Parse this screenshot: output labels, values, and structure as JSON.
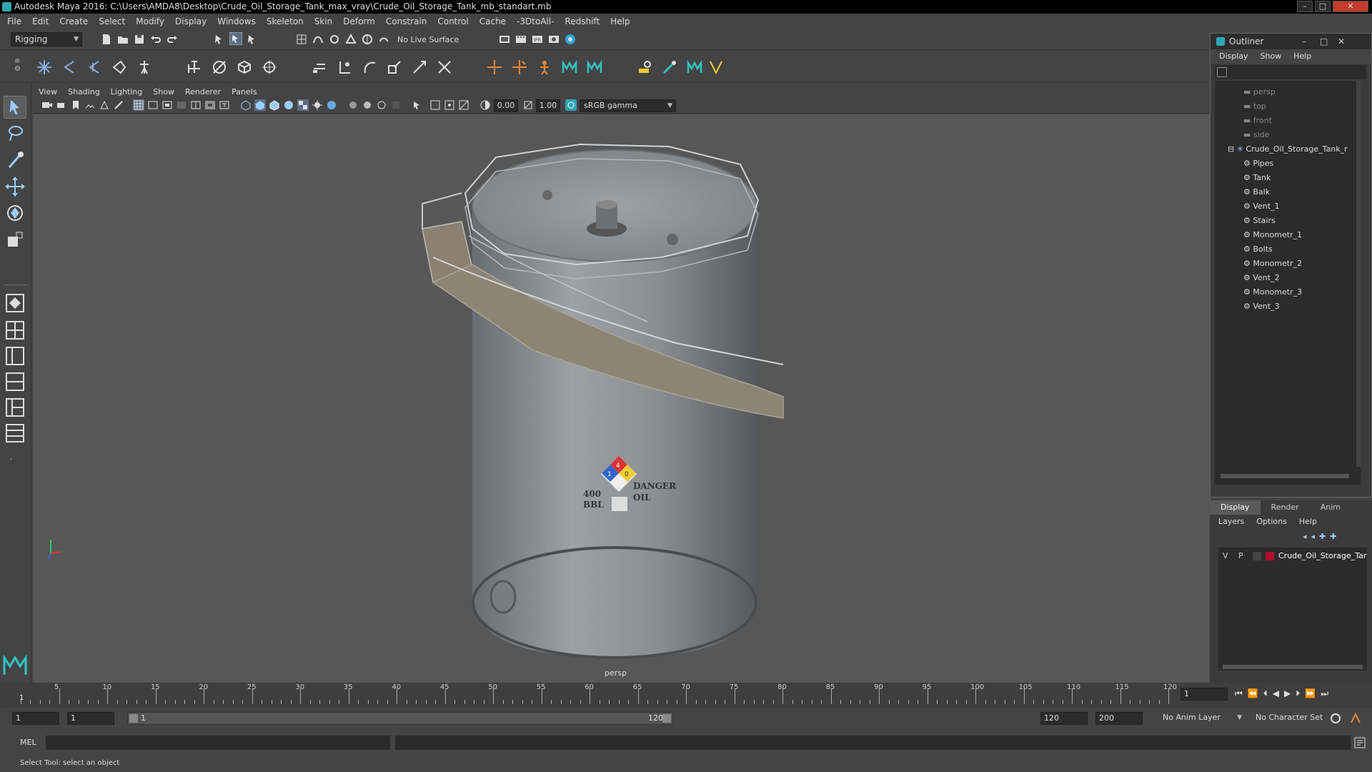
{
  "window": {
    "title": "Autodesk Maya 2016: C:\\Users\\AMDA8\\Desktop\\Crude_Oil_Storage_Tank_max_vray\\Crude_Oil_Storage_Tank_mb_standart.mb"
  },
  "menubar": [
    "File",
    "Edit",
    "Create",
    "Select",
    "Modify",
    "Display",
    "Windows",
    "Skeleton",
    "Skin",
    "Deform",
    "Constrain",
    "Control",
    "Cache",
    "-3DtoAll-",
    "Redshift",
    "Help"
  ],
  "statusline": {
    "mode": "Rigging",
    "live_surface": "No Live Surface"
  },
  "panel_menu": [
    "View",
    "Shading",
    "Lighting",
    "Show",
    "Renderer",
    "Panels"
  ],
  "panel_toolbar": {
    "exposure": "0.00",
    "gamma": "1.00",
    "colorspace": "sRGB gamma"
  },
  "viewport": {
    "camera_label": "persp",
    "decal": {
      "left_line1": "400",
      "left_line2": "BBL",
      "right_line1": "DANGER",
      "right_line2": "OIL",
      "fire": "4",
      "health": "1",
      "reactivity": "0"
    }
  },
  "outliner": {
    "title": "Outliner",
    "menu": [
      "Display",
      "Show",
      "Help"
    ],
    "cameras": [
      "persp",
      "top",
      "front",
      "side"
    ],
    "root": "Crude_Oil_Storage_Tank_r",
    "children": [
      "Pipes",
      "Tank",
      "Balk",
      "Vent_1",
      "Stairs",
      "Monometr_1",
      "Bolts",
      "Monometr_2",
      "Vent_2",
      "Monometr_3",
      "Vent_3"
    ]
  },
  "layer_editor": {
    "tabs": [
      "Display",
      "Render",
      "Anim"
    ],
    "menu": [
      "Layers",
      "Options",
      "Help"
    ],
    "layer": {
      "v": "V",
      "p": "P",
      "name": "Crude_Oil_Storage_Tar",
      "color": "#b0102a"
    }
  },
  "timeline": {
    "ticks": [
      "5",
      "10",
      "15",
      "20",
      "25",
      "30",
      "35",
      "40",
      "45",
      "50",
      "55",
      "60",
      "65",
      "70",
      "75",
      "80",
      "85",
      "90",
      "95",
      "100",
      "105",
      "110",
      "115",
      "120"
    ],
    "start_marker": "1",
    "current_frame": "1"
  },
  "range": {
    "start": "1",
    "playback_start": "1",
    "slider_start": "1",
    "slider_end": "120",
    "playback_end": "120",
    "end": "200",
    "anim_layer": "No Anim Layer",
    "character_set": "No Character Set"
  },
  "cmdline": {
    "label": "MEL"
  },
  "helpline": {
    "text": "Select Tool: select an object"
  },
  "colors": {
    "accent": "#2fa5b5",
    "viewport_bg": "#575757",
    "selected_tool": "#5d5d5d"
  }
}
